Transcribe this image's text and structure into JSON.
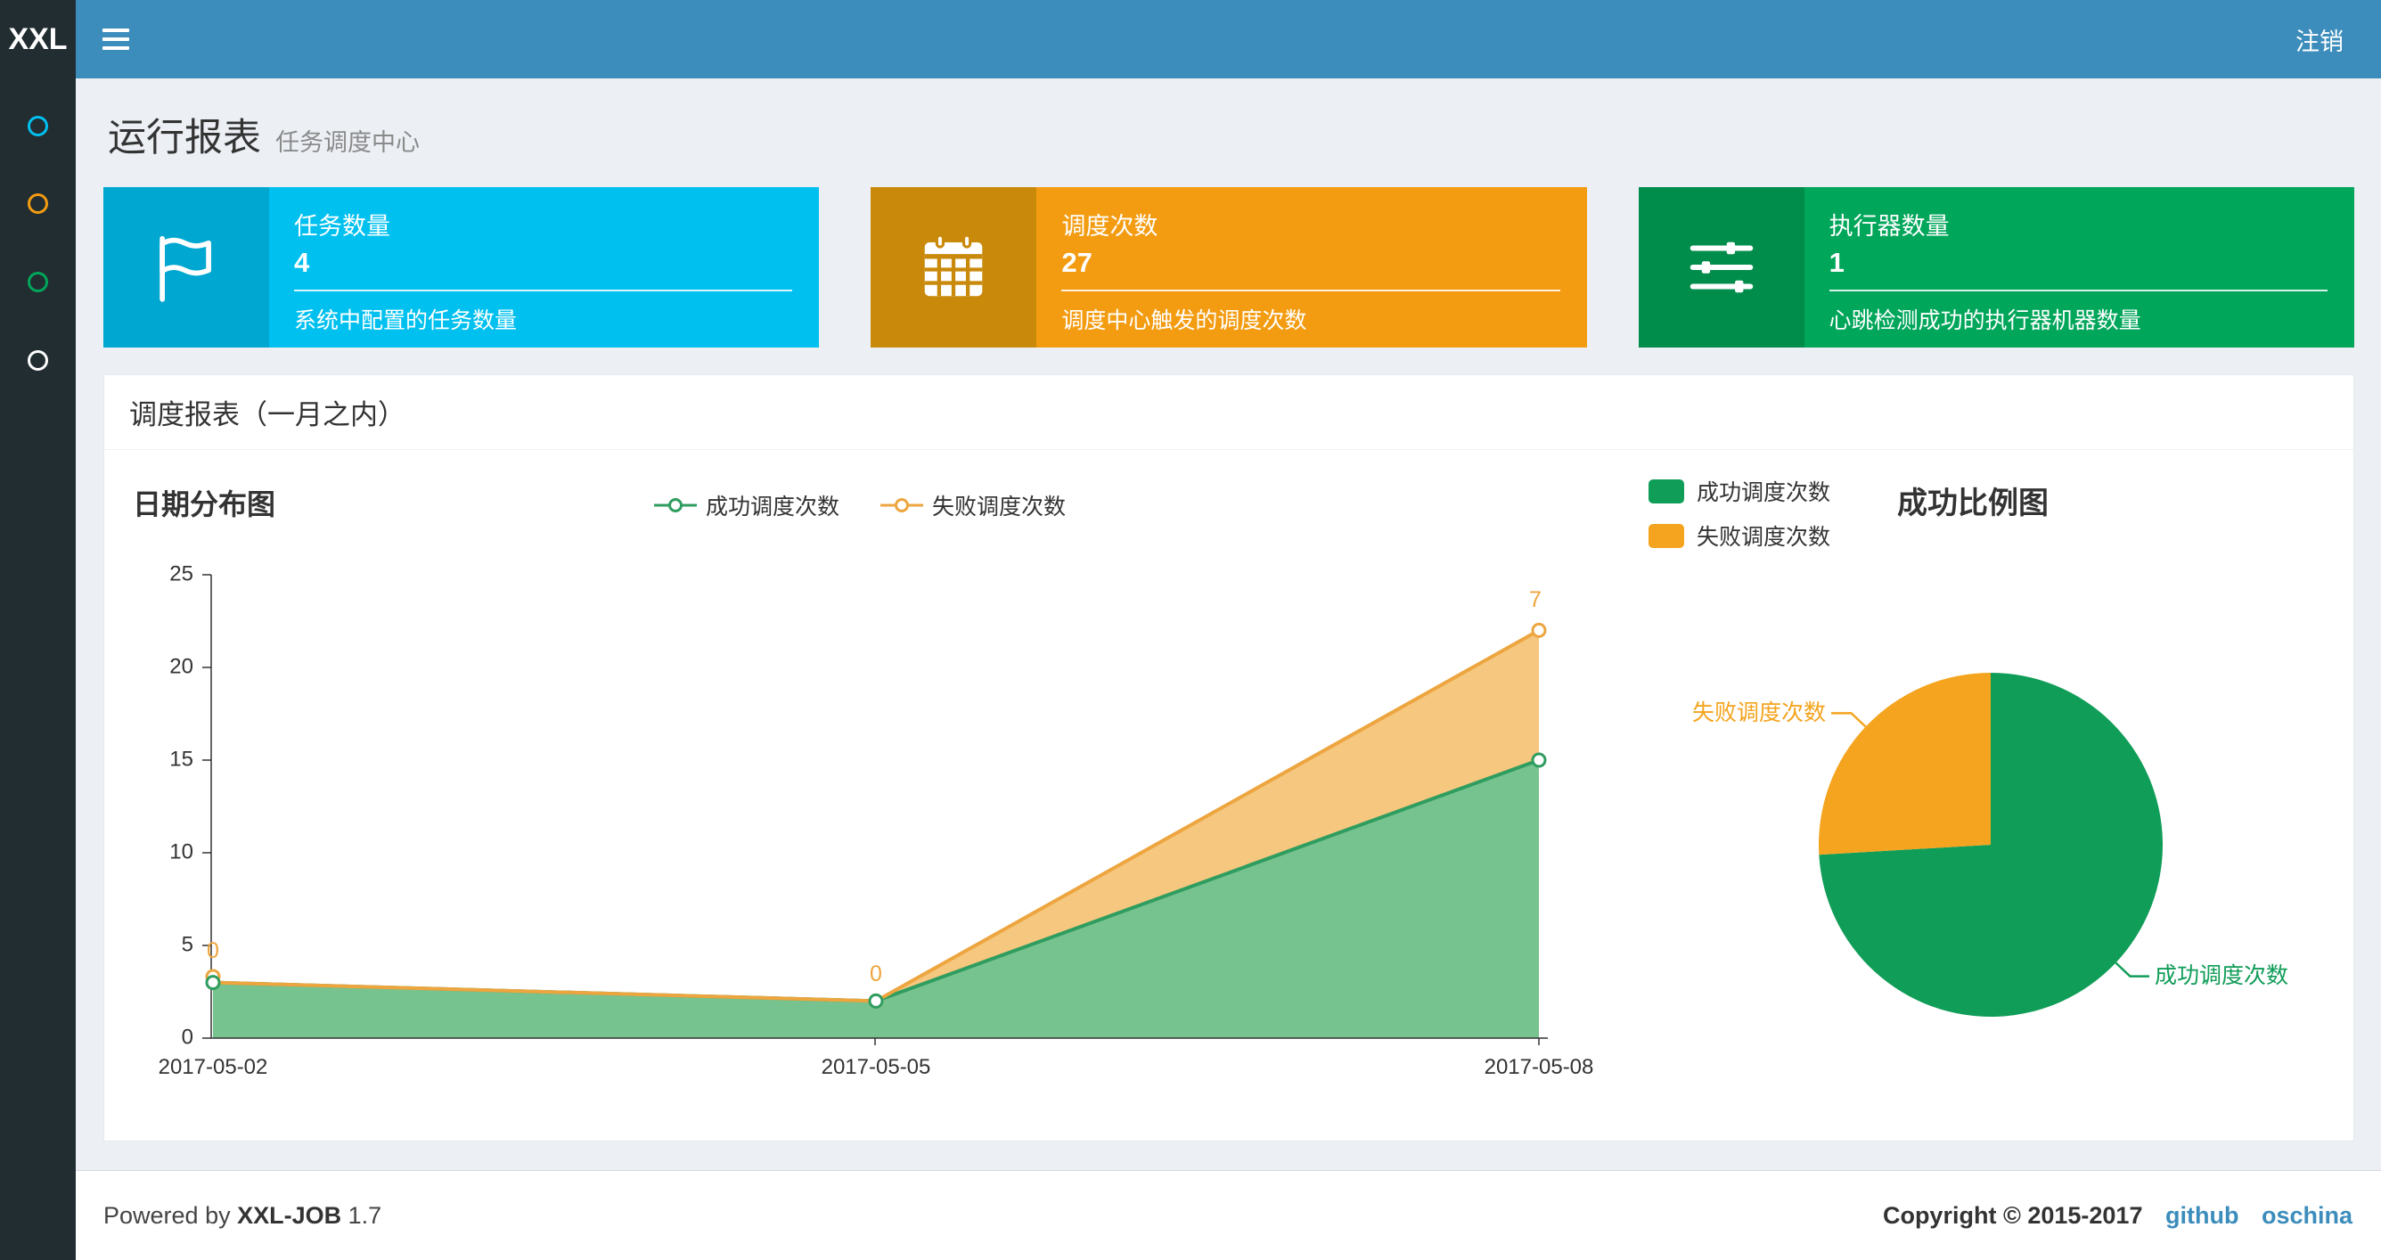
{
  "navbar": {
    "logo": "XXL",
    "logout": "注销"
  },
  "sidebar": {
    "items": [
      {
        "icon": "circle-icon",
        "color": "#00c0ef"
      },
      {
        "icon": "circle-icon",
        "color": "#f39c12"
      },
      {
        "icon": "circle-icon",
        "color": "#00a65a"
      },
      {
        "icon": "circle-icon",
        "color": "#ffffff"
      }
    ]
  },
  "header": {
    "title": "运行报表",
    "subtitle": "任务调度中心"
  },
  "info_boxes": [
    {
      "title": "任务数量",
      "value": "4",
      "desc": "系统中配置的任务数量",
      "icon": "flag-icon",
      "color": "#00c0ef",
      "icon_bg": "#00a7d0"
    },
    {
      "title": "调度次数",
      "value": "27",
      "desc": "调度中心触发的调度次数",
      "icon": "calendar-icon",
      "color": "#f39c12",
      "icon_bg": "#c98a0c"
    },
    {
      "title": "执行器数量",
      "value": "1",
      "desc": "心跳检测成功的执行器机器数量",
      "icon": "sliders-icon",
      "color": "#00a65a",
      "icon_bg": "#008d4c"
    }
  ],
  "panel": {
    "title": "调度报表（一月之内）"
  },
  "chart_data": [
    {
      "type": "area",
      "title": "日期分布图",
      "stacked": true,
      "categories": [
        "2017-05-02",
        "2017-05-05",
        "2017-05-08"
      ],
      "series": [
        {
          "name": "成功调度次数",
          "values": [
            3,
            2,
            15
          ],
          "line_color": "#2f9d5f",
          "fill_color": "#68bd83"
        },
        {
          "name": "失败调度次数",
          "values": [
            0,
            0,
            7
          ],
          "line_color": "#eda53f",
          "fill_color": "#f5c171"
        }
      ],
      "ylim": [
        0,
        25
      ],
      "yticks": [
        "25",
        "20",
        "15",
        "10",
        "5",
        "0"
      ],
      "fail_point_labels": [
        "0",
        "0",
        "7"
      ],
      "legend_position": "top"
    },
    {
      "type": "pie",
      "title": "成功比例图",
      "slices": [
        {
          "name": "成功调度次数",
          "value": 20,
          "color": "#109d58"
        },
        {
          "name": "失败调度次数",
          "value": 7,
          "color": "#f4a41e"
        }
      ],
      "legend_position": "left-top"
    }
  ],
  "footer": {
    "powered_by": "Powered by",
    "product": "XXL-JOB",
    "version": "1.7",
    "copyright": "Copyright © 2015-2017",
    "link_github": "github",
    "link_oschina": "oschina"
  }
}
